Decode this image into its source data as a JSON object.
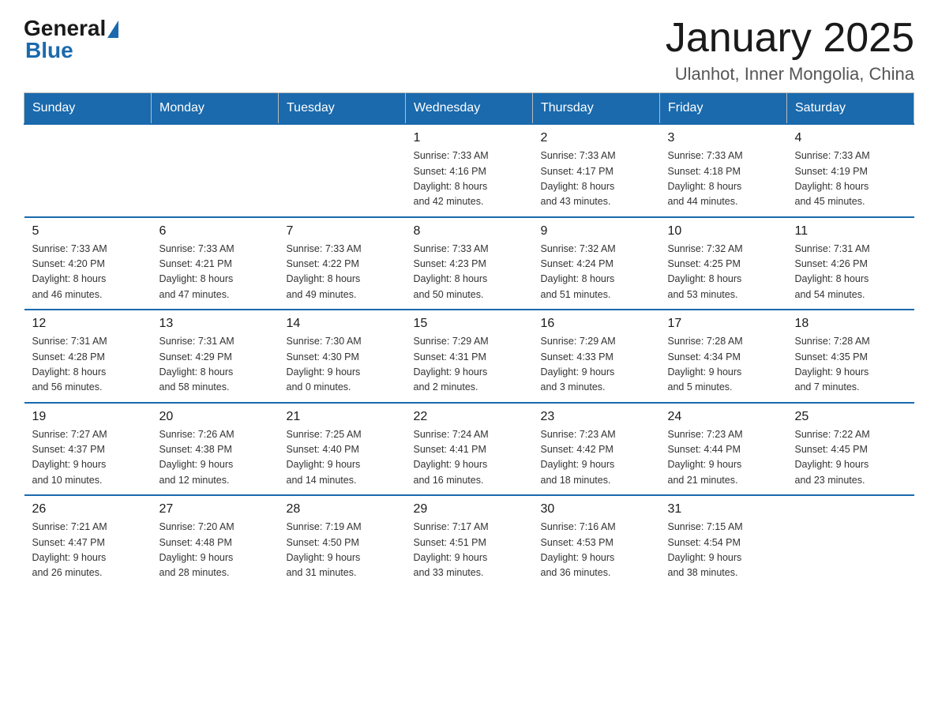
{
  "header": {
    "logo_general": "General",
    "logo_blue": "Blue",
    "month_title": "January 2025",
    "location": "Ulanhot, Inner Mongolia, China"
  },
  "days_of_week": [
    "Sunday",
    "Monday",
    "Tuesday",
    "Wednesday",
    "Thursday",
    "Friday",
    "Saturday"
  ],
  "weeks": [
    [
      {
        "day": "",
        "info": ""
      },
      {
        "day": "",
        "info": ""
      },
      {
        "day": "",
        "info": ""
      },
      {
        "day": "1",
        "info": "Sunrise: 7:33 AM\nSunset: 4:16 PM\nDaylight: 8 hours\nand 42 minutes."
      },
      {
        "day": "2",
        "info": "Sunrise: 7:33 AM\nSunset: 4:17 PM\nDaylight: 8 hours\nand 43 minutes."
      },
      {
        "day": "3",
        "info": "Sunrise: 7:33 AM\nSunset: 4:18 PM\nDaylight: 8 hours\nand 44 minutes."
      },
      {
        "day": "4",
        "info": "Sunrise: 7:33 AM\nSunset: 4:19 PM\nDaylight: 8 hours\nand 45 minutes."
      }
    ],
    [
      {
        "day": "5",
        "info": "Sunrise: 7:33 AM\nSunset: 4:20 PM\nDaylight: 8 hours\nand 46 minutes."
      },
      {
        "day": "6",
        "info": "Sunrise: 7:33 AM\nSunset: 4:21 PM\nDaylight: 8 hours\nand 47 minutes."
      },
      {
        "day": "7",
        "info": "Sunrise: 7:33 AM\nSunset: 4:22 PM\nDaylight: 8 hours\nand 49 minutes."
      },
      {
        "day": "8",
        "info": "Sunrise: 7:33 AM\nSunset: 4:23 PM\nDaylight: 8 hours\nand 50 minutes."
      },
      {
        "day": "9",
        "info": "Sunrise: 7:32 AM\nSunset: 4:24 PM\nDaylight: 8 hours\nand 51 minutes."
      },
      {
        "day": "10",
        "info": "Sunrise: 7:32 AM\nSunset: 4:25 PM\nDaylight: 8 hours\nand 53 minutes."
      },
      {
        "day": "11",
        "info": "Sunrise: 7:31 AM\nSunset: 4:26 PM\nDaylight: 8 hours\nand 54 minutes."
      }
    ],
    [
      {
        "day": "12",
        "info": "Sunrise: 7:31 AM\nSunset: 4:28 PM\nDaylight: 8 hours\nand 56 minutes."
      },
      {
        "day": "13",
        "info": "Sunrise: 7:31 AM\nSunset: 4:29 PM\nDaylight: 8 hours\nand 58 minutes."
      },
      {
        "day": "14",
        "info": "Sunrise: 7:30 AM\nSunset: 4:30 PM\nDaylight: 9 hours\nand 0 minutes."
      },
      {
        "day": "15",
        "info": "Sunrise: 7:29 AM\nSunset: 4:31 PM\nDaylight: 9 hours\nand 2 minutes."
      },
      {
        "day": "16",
        "info": "Sunrise: 7:29 AM\nSunset: 4:33 PM\nDaylight: 9 hours\nand 3 minutes."
      },
      {
        "day": "17",
        "info": "Sunrise: 7:28 AM\nSunset: 4:34 PM\nDaylight: 9 hours\nand 5 minutes."
      },
      {
        "day": "18",
        "info": "Sunrise: 7:28 AM\nSunset: 4:35 PM\nDaylight: 9 hours\nand 7 minutes."
      }
    ],
    [
      {
        "day": "19",
        "info": "Sunrise: 7:27 AM\nSunset: 4:37 PM\nDaylight: 9 hours\nand 10 minutes."
      },
      {
        "day": "20",
        "info": "Sunrise: 7:26 AM\nSunset: 4:38 PM\nDaylight: 9 hours\nand 12 minutes."
      },
      {
        "day": "21",
        "info": "Sunrise: 7:25 AM\nSunset: 4:40 PM\nDaylight: 9 hours\nand 14 minutes."
      },
      {
        "day": "22",
        "info": "Sunrise: 7:24 AM\nSunset: 4:41 PM\nDaylight: 9 hours\nand 16 minutes."
      },
      {
        "day": "23",
        "info": "Sunrise: 7:23 AM\nSunset: 4:42 PM\nDaylight: 9 hours\nand 18 minutes."
      },
      {
        "day": "24",
        "info": "Sunrise: 7:23 AM\nSunset: 4:44 PM\nDaylight: 9 hours\nand 21 minutes."
      },
      {
        "day": "25",
        "info": "Sunrise: 7:22 AM\nSunset: 4:45 PM\nDaylight: 9 hours\nand 23 minutes."
      }
    ],
    [
      {
        "day": "26",
        "info": "Sunrise: 7:21 AM\nSunset: 4:47 PM\nDaylight: 9 hours\nand 26 minutes."
      },
      {
        "day": "27",
        "info": "Sunrise: 7:20 AM\nSunset: 4:48 PM\nDaylight: 9 hours\nand 28 minutes."
      },
      {
        "day": "28",
        "info": "Sunrise: 7:19 AM\nSunset: 4:50 PM\nDaylight: 9 hours\nand 31 minutes."
      },
      {
        "day": "29",
        "info": "Sunrise: 7:17 AM\nSunset: 4:51 PM\nDaylight: 9 hours\nand 33 minutes."
      },
      {
        "day": "30",
        "info": "Sunrise: 7:16 AM\nSunset: 4:53 PM\nDaylight: 9 hours\nand 36 minutes."
      },
      {
        "day": "31",
        "info": "Sunrise: 7:15 AM\nSunset: 4:54 PM\nDaylight: 9 hours\nand 38 minutes."
      },
      {
        "day": "",
        "info": ""
      }
    ]
  ],
  "colors": {
    "header_bg": "#1a6aad",
    "header_text": "#ffffff",
    "border_top": "#1a6aad"
  }
}
